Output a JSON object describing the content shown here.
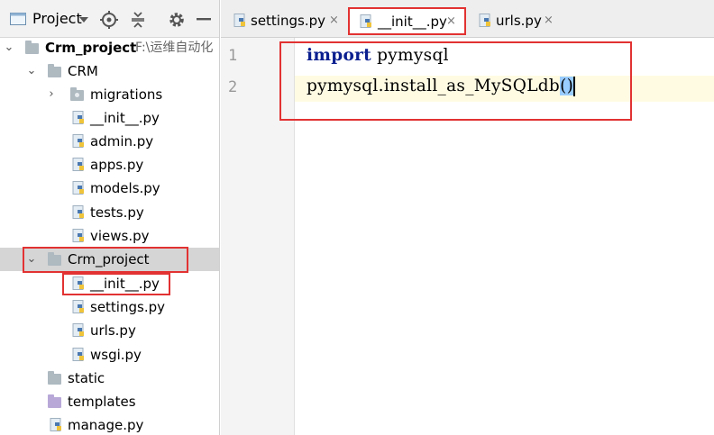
{
  "project_panel": {
    "title": "Project",
    "root": {
      "name": "Crm_project",
      "path": "F:\\运维自动化"
    },
    "crm_folder": "CRM",
    "crm_items": [
      "migrations",
      "__init__.py",
      "admin.py",
      "apps.py",
      "models.py",
      "tests.py",
      "views.py"
    ],
    "project_pkg": "Crm_project",
    "project_items": [
      "__init__.py",
      "settings.py",
      "urls.py",
      "wsgi.py"
    ],
    "root_items": [
      "static",
      "templates",
      "manage.py"
    ]
  },
  "tabs": [
    {
      "label": "settings.py",
      "close": "×",
      "active": false
    },
    {
      "label": "__init__.py",
      "close": "×",
      "active": true
    },
    {
      "label": "urls.py",
      "close": "×",
      "active": false
    }
  ],
  "editor": {
    "line_numbers": [
      "1",
      "2"
    ],
    "line1": {
      "keyword": "import",
      "rest": " pymysql"
    },
    "line2": {
      "text": "pymysql.install_as_MySQLdb",
      "parens": "()"
    }
  },
  "colors": {
    "highlight_box": "#e23232",
    "keyword": "#0b1f8f",
    "current_line": "#fffbe3",
    "brace_match": "#99ccff"
  }
}
